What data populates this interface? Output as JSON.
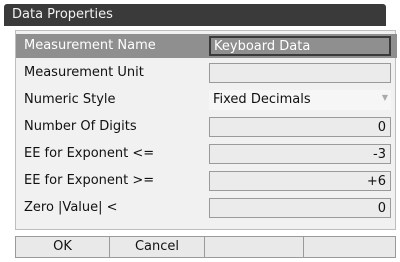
{
  "dialog": {
    "title": "Data Properties"
  },
  "rows": [
    {
      "label": "Measurement Name",
      "value": "Keyboard Data"
    },
    {
      "label": "Measurement Unit",
      "value": ""
    },
    {
      "label": "Numeric Style",
      "value": "Fixed Decimals"
    },
    {
      "label": "Number Of Digits",
      "value": "0"
    },
    {
      "label": "EE for Exponent <=",
      "value": "-3"
    },
    {
      "label": "EE for Exponent >=",
      "value": "+6"
    },
    {
      "label": "Zero |Value| <",
      "value": "0"
    }
  ],
  "softkeys": {
    "ok": "OK",
    "cancel": "Cancel"
  }
}
